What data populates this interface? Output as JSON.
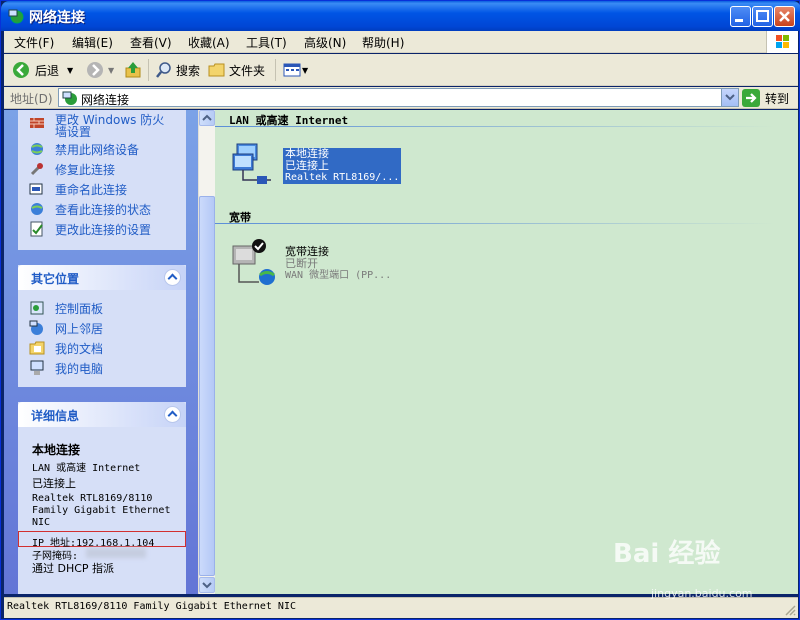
{
  "window": {
    "title": "网络连接"
  },
  "menubar": {
    "items": [
      "文件(F)",
      "编辑(E)",
      "查看(V)",
      "收藏(A)",
      "工具(T)",
      "高级(N)",
      "帮助(H)"
    ]
  },
  "toolbar": {
    "back": "后退",
    "search": "搜索",
    "folders": "文件夹"
  },
  "addressbar": {
    "label": "地址(D)",
    "value": "网络连接",
    "go": "转到"
  },
  "left": {
    "tasks": [
      {
        "label": "更改 Windows 防火墙设置",
        "icon": "firewall-icon"
      },
      {
        "label": "禁用此网络设备",
        "icon": "globe-disable-icon"
      },
      {
        "label": "修复此连接",
        "icon": "wrench-icon"
      },
      {
        "label": "重命名此连接",
        "icon": "rename-icon"
      },
      {
        "label": "查看此连接的状态",
        "icon": "status-icon"
      },
      {
        "label": "更改此连接的设置",
        "icon": "settings-icon"
      }
    ],
    "other_places": {
      "title": "其它位置",
      "items": [
        "控制面板",
        "网上邻居",
        "我的文档",
        "我的电脑"
      ]
    },
    "details": {
      "title": "详细信息",
      "name": "本地连接",
      "type": "LAN 或高速 Internet",
      "status": "已连接上",
      "device_l1": "Realtek RTL8169/8110",
      "device_l2": "Family Gigabit Ethernet",
      "device_l3": "NIC",
      "ip": "IP 地址:192.168.1.104",
      "subnet": "子网掩码:",
      "dhcp": "通过 DHCP 指派"
    }
  },
  "content": {
    "groups": [
      {
        "title": "LAN 或高速 Internet",
        "connection": {
          "name": "本地连接",
          "status": "已连接上",
          "device": "Realtek RTL8169/..."
        }
      },
      {
        "title": "宽带",
        "connection": {
          "name": "宽带连接",
          "status": "已断开",
          "device": "WAN 微型端口 (PP..."
        }
      }
    ]
  },
  "statusbar": {
    "text": "Realtek RTL8169/8110 Family Gigabit Ethernet NIC"
  },
  "watermark": {
    "text": "Bai 经验",
    "sub": "jingyan.baidu.com"
  },
  "colors": {
    "title_blue": "#0055e5",
    "link_blue": "#215dc6",
    "content_bg": "#cfe8cf",
    "selection": "#316ac5"
  }
}
